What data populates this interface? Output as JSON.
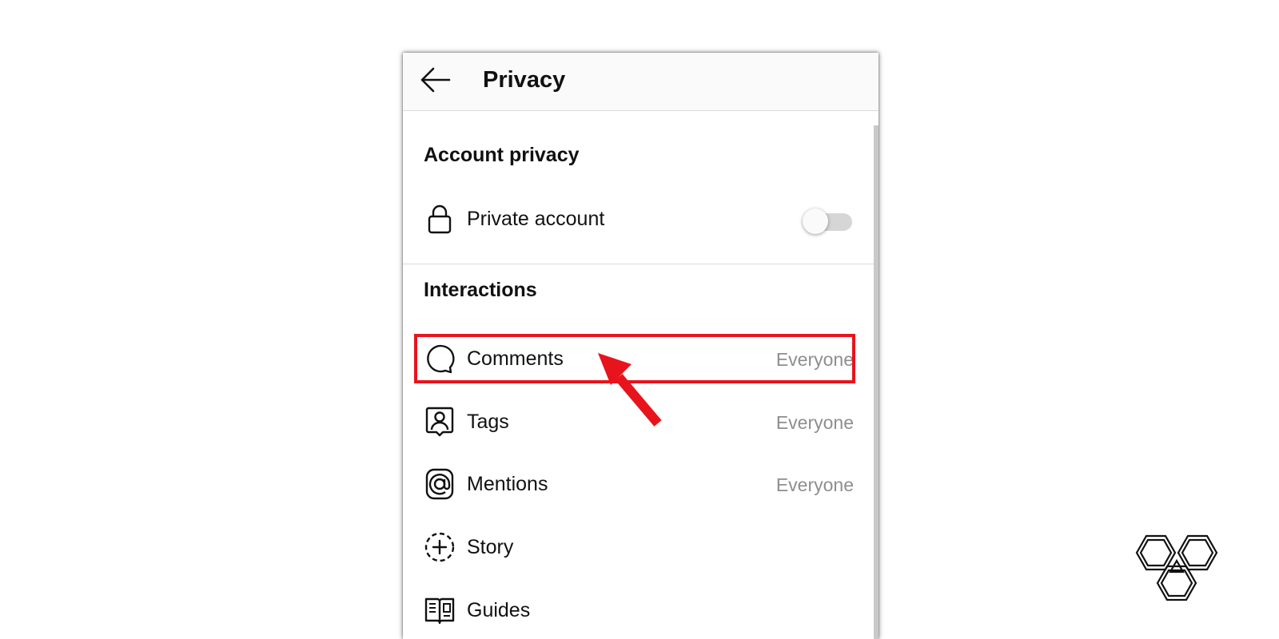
{
  "header": {
    "title": "Privacy",
    "back_icon": "arrow-left-icon"
  },
  "sections": {
    "account_privacy": {
      "title": "Account privacy",
      "private_account": {
        "label": "Private account",
        "icon": "lock-icon",
        "enabled": false
      }
    },
    "interactions": {
      "title": "Interactions",
      "items": [
        {
          "label": "Comments",
          "value": "Everyone",
          "icon": "comment-icon",
          "highlighted": true
        },
        {
          "label": "Tags",
          "value": "Everyone",
          "icon": "tag-person-icon"
        },
        {
          "label": "Mentions",
          "value": "Everyone",
          "icon": "at-sign-icon"
        },
        {
          "label": "Story",
          "value": "",
          "icon": "story-add-icon"
        },
        {
          "label": "Guides",
          "value": "",
          "icon": "guides-icon"
        }
      ]
    }
  },
  "annotation": {
    "highlight_color": "#e8141c",
    "arrow_color": "#e8141c"
  },
  "colors": {
    "header_bg": "#fafafa",
    "secondary_text": "#8e8e8e",
    "divider": "#dbdbdb"
  },
  "watermark": {
    "icon": "hexagon-logo-icon"
  }
}
